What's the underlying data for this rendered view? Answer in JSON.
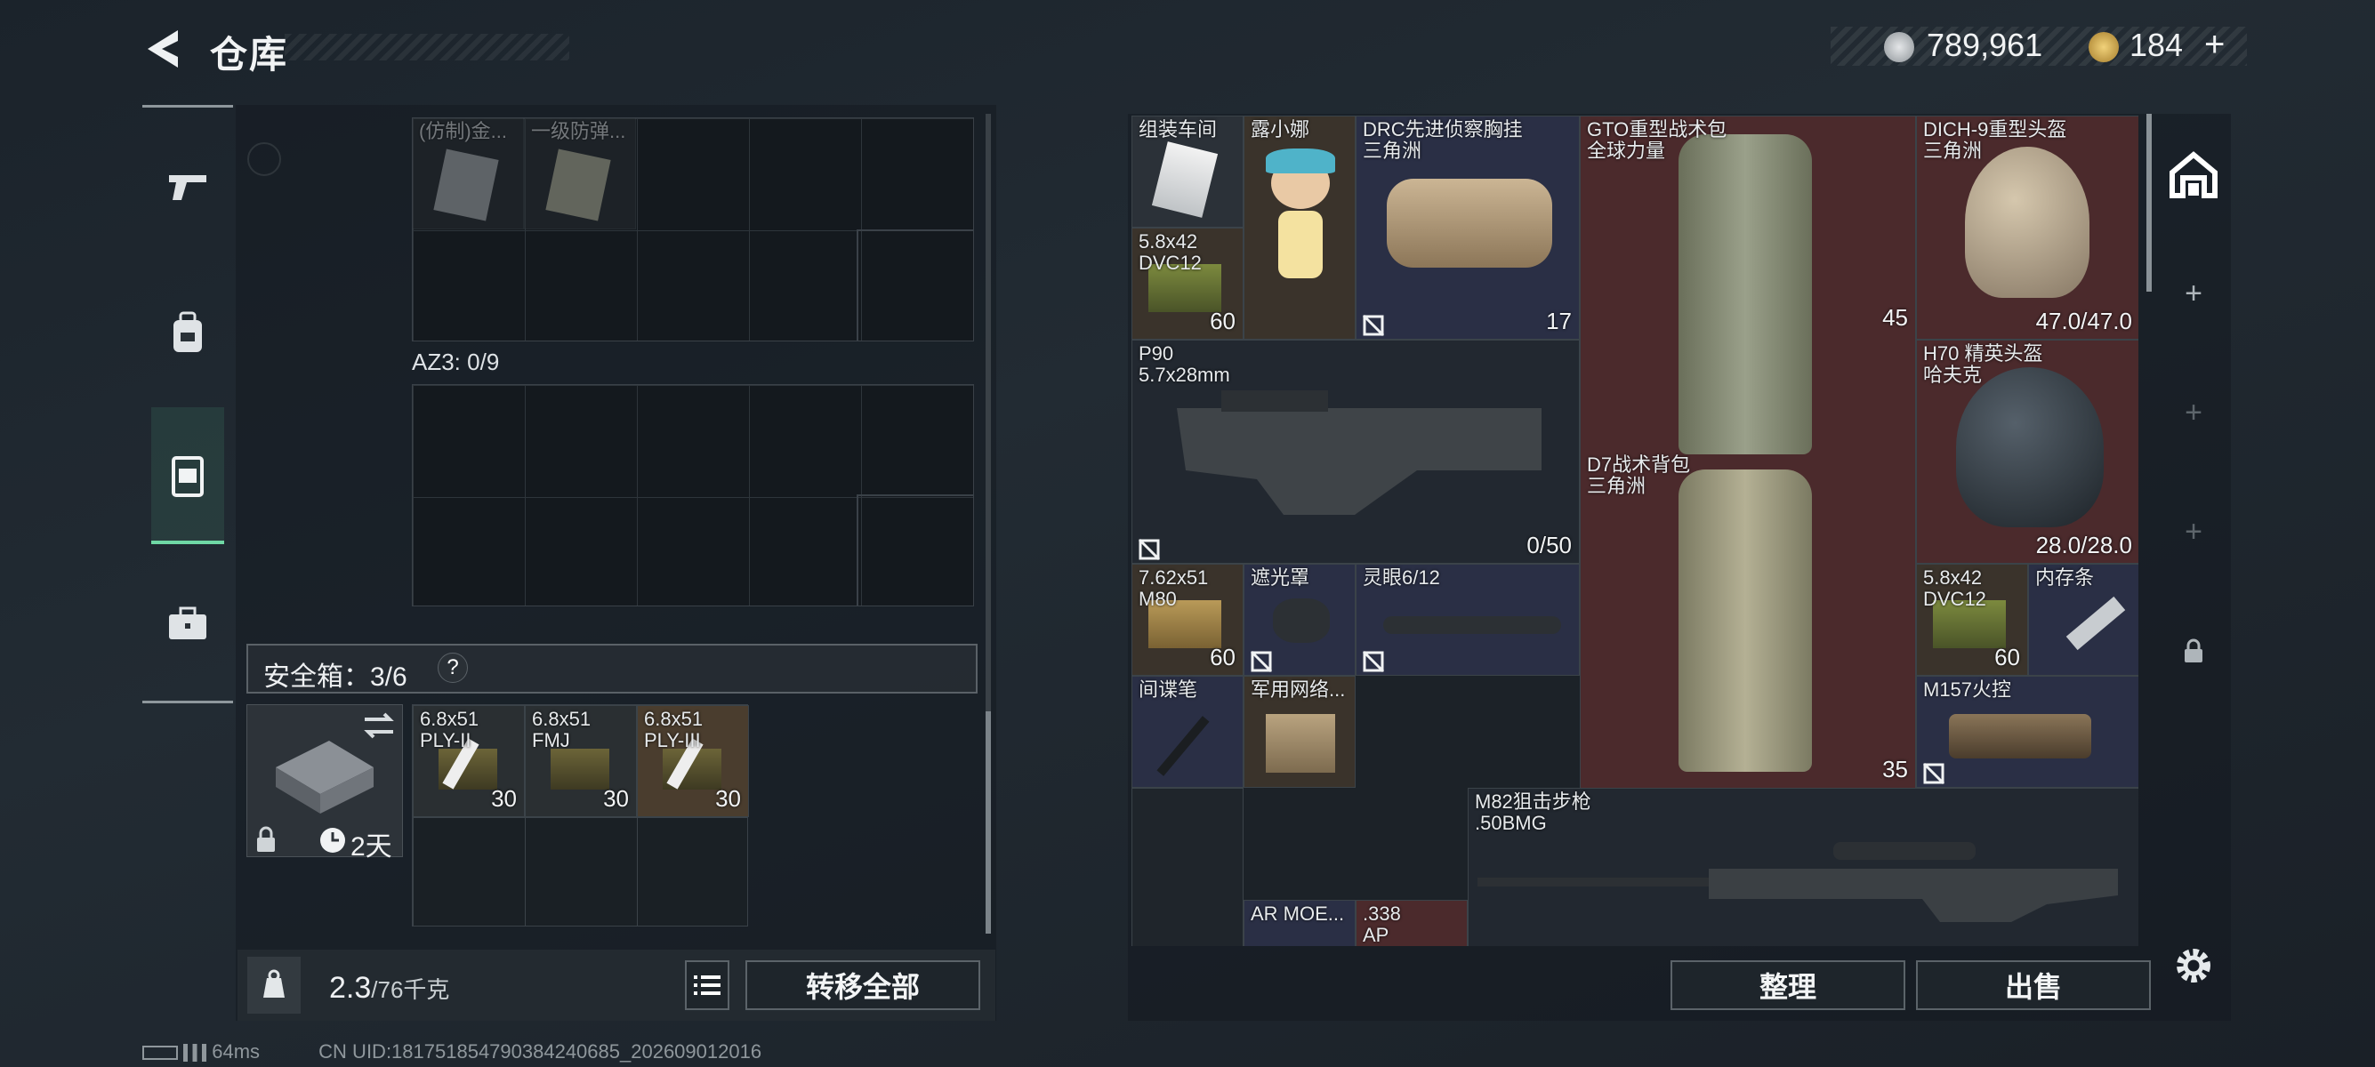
{
  "header": {
    "title": "仓库",
    "currency": [
      {
        "icon": "silver-coin-icon",
        "value": "789,961"
      },
      {
        "icon": "gold-coin-icon",
        "value": "184",
        "plus": "+"
      }
    ]
  },
  "left": {
    "faded_items": [
      "(仿制)金...",
      "一级防弹..."
    ],
    "az3_label": "AZ3: 0/9",
    "safebox_label": "安全箱：3/6",
    "help": "?",
    "safe_days": "2天",
    "safe_items": [
      {
        "name": "6.8x51\nPLY-II",
        "count": "30"
      },
      {
        "name": "6.8x51\nFMJ",
        "count": "30"
      },
      {
        "name": "6.8x51\nPLY-III",
        "count": "30"
      }
    ],
    "weight_value": "2.3",
    "weight_cap": "/76千克",
    "transfer_all": "转移全部"
  },
  "right": {
    "items": [
      {
        "name": "组装车间"
      },
      {
        "name": "露小娜"
      },
      {
        "name": "DRC先进侦察胸挂\n三角洲",
        "badge": "17"
      },
      {
        "name": "GTO重型战术包\n全球力量",
        "badge": "45"
      },
      {
        "name": "DICH-9重型头盔\n三角洲",
        "count": "47.0/47.0"
      },
      {
        "name": "5.8x42\nDVC12",
        "count": "60"
      },
      {
        "name": "P90\n5.7x28mm",
        "count": "0/50"
      },
      {
        "name": "H70 精英头盔\n哈夫克",
        "count": "28.0/28.0"
      },
      {
        "name": "D7战术背包\n三角洲",
        "badge": "35"
      },
      {
        "name": "7.62x51\nM80",
        "count": "60"
      },
      {
        "name": "遮光罩"
      },
      {
        "name": "灵眼6/12"
      },
      {
        "name": "5.8x42\nDVC12",
        "count": "60"
      },
      {
        "name": "内存条"
      },
      {
        "name": "间谍笔"
      },
      {
        "name": "军用网络..."
      },
      {
        "name": "M157火控"
      },
      {
        "name": "M82狙击步枪\n.50BMG"
      },
      {
        "name": "AR MOE..."
      },
      {
        "name": ".338\nAP"
      }
    ],
    "sort": "整理",
    "sell": "出售"
  },
  "footer": {
    "ping": "64ms",
    "uid": "CN UID:1817518547903842406​85_202609012016"
  }
}
